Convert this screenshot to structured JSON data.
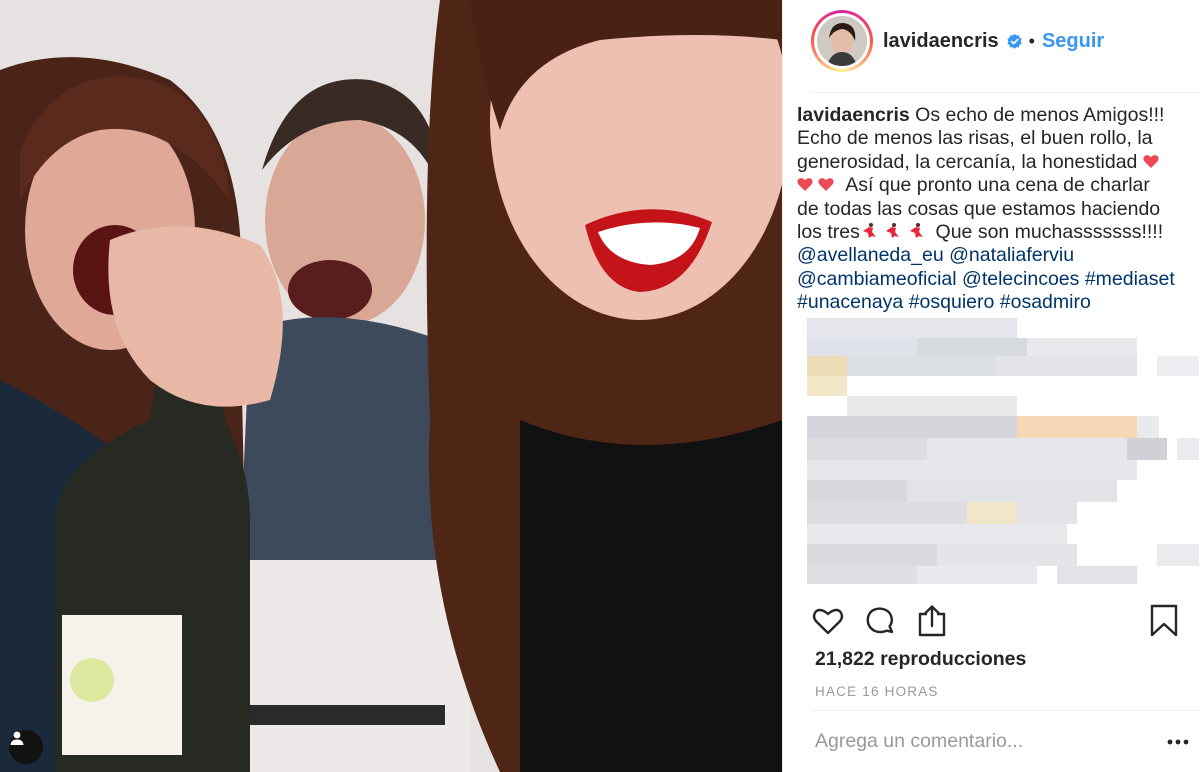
{
  "post": {
    "username": "lavidaencris",
    "verified": true,
    "separator": "•",
    "follow_label": "Seguir",
    "caption": {
      "username": "lavidaencris",
      "line1": "Os echo de menos Amigos!!!",
      "line2": "Echo de menos las risas, el buen rollo, la",
      "line3": "generosidad, la cercanía, la honestidad",
      "line4": "Así que pronto una cena de charlar",
      "line5": "de todas las cosas que estamos haciendo",
      "line6a": "los tres",
      "line6b": "Que son muchasssssss!!!!",
      "mention1": "@avellaneda_eu",
      "mention2": "@nataliaferviu",
      "mention3": "@cambiameoficial",
      "mention4": "@telecincoes",
      "hashtag1": "#mediaset",
      "hashtag2": "#unacenaya",
      "hashtag3": "#osquiero",
      "hashtag4": "#osadmiro"
    },
    "views_count": "21,822",
    "views_label": "reproducciones",
    "timestamp": "HACE 16 HORAS",
    "comment_placeholder": "Agrega un comentario...",
    "colors": {
      "link": "#003569",
      "follow": "#3897f0",
      "verified": "#3897f0",
      "emoji_heart": "#ed4956"
    },
    "icons": [
      "heart-icon",
      "comment-icon",
      "share-icon",
      "bookmark-icon",
      "more-options-icon",
      "user-tag-icon",
      "verified-icon"
    ]
  }
}
